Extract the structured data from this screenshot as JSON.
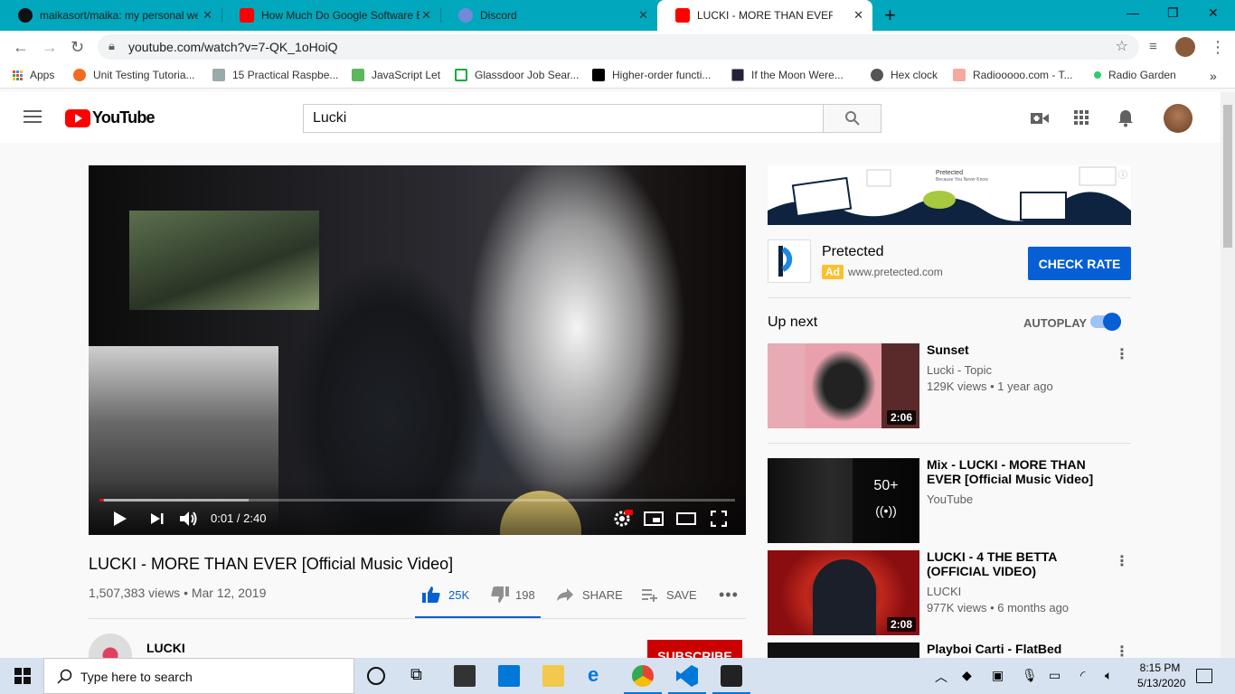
{
  "browser": {
    "tabs": [
      {
        "title": "maikasort/maika: my personal we",
        "icon": "github-icon"
      },
      {
        "title": "How Much Do Google Software E",
        "icon": "youtube-icon"
      },
      {
        "title": "Discord",
        "icon": "discord-icon"
      },
      {
        "title": "LUCKI - MORE THAN EVER [C",
        "icon": "youtube-icon"
      }
    ],
    "url": "youtube.com/watch?v=7-QK_1oHoiQ",
    "bookmarks": [
      {
        "label": "Apps"
      },
      {
        "label": "Unit Testing Tutoria..."
      },
      {
        "label": "15 Practical Raspbe..."
      },
      {
        "label": "JavaScript Let"
      },
      {
        "label": "Glassdoor Job Sear..."
      },
      {
        "label": "Higher-order functi..."
      },
      {
        "label": "If the Moon Were..."
      },
      {
        "label": "Hex clock"
      },
      {
        "label": "Radiooooo.com - T..."
      },
      {
        "label": "Radio Garden"
      }
    ]
  },
  "youtube": {
    "logo_text": "YouTube",
    "search_value": "Lucki",
    "player": {
      "time": "0:01 / 2:40",
      "progress": 0.006
    },
    "video": {
      "title": "LUCKI - MORE THAN EVER [Official Music Video]",
      "meta": "1,507,383 views • Mar 12, 2019",
      "likes": "25K",
      "dislikes": "198",
      "share": "SHARE",
      "save": "SAVE"
    },
    "channel": {
      "name": "LUCKI",
      "subscribe": "SUBSCRIBE"
    },
    "ad": {
      "banner_brand": "Pretected",
      "banner_tagline": "Because You Never Know",
      "name": "Pretected",
      "badge": "Ad",
      "url": "www.pretected.com",
      "cta": "CHECK RATE"
    },
    "up_next": {
      "label": "Up next",
      "autoplay": "AUTOPLAY",
      "autoplay_on": true
    },
    "recommendations": [
      {
        "title": "Sunset",
        "channel": "Lucki - Topic",
        "meta": "129K views • 1 year ago",
        "duration": "2:06"
      },
      {
        "title": "Mix - LUCKI - MORE THAN EVER [Official Music Video]",
        "channel": "YouTube",
        "meta": "",
        "count": "50+"
      },
      {
        "title": "LUCKI - 4 THE BETTA (OFFICIAL VIDEO)",
        "channel": "LUCKI",
        "meta": "977K views • 6 months ago",
        "duration": "2:08"
      },
      {
        "title": "Playboi Carti - FlatBed Freestyle",
        "channel": "",
        "meta": ""
      }
    ]
  },
  "taskbar": {
    "search_placeholder": "Type here to search",
    "time": "8:15 PM",
    "date": "5/13/2020"
  }
}
